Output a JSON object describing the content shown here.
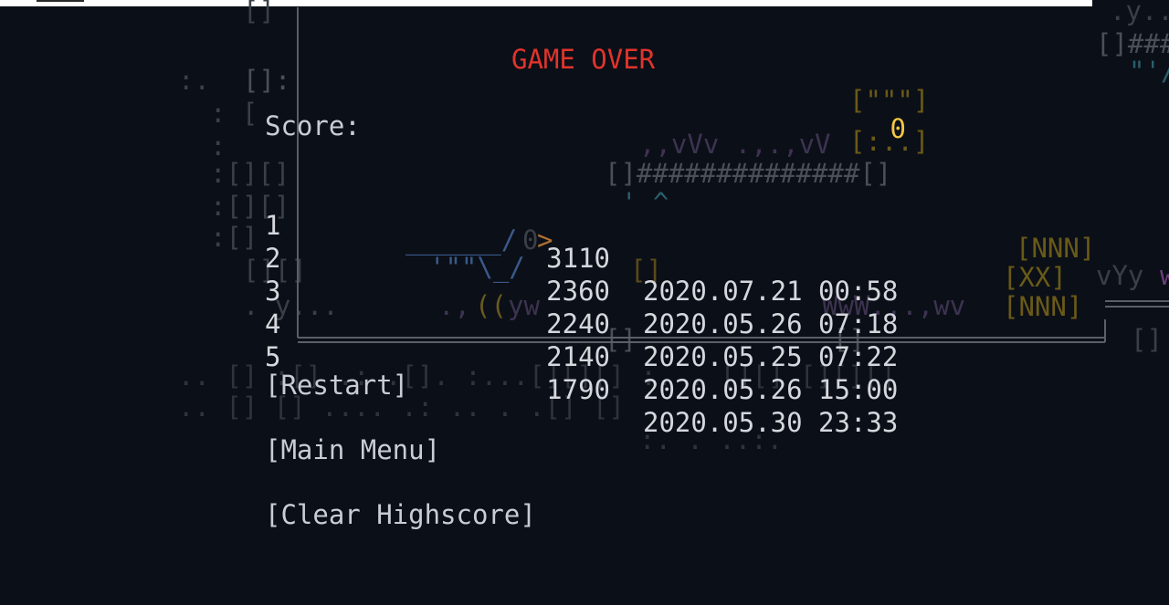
{
  "game": {
    "title": "GAME OVER",
    "score_label": "Score:",
    "score_value": "0"
  },
  "highscores": [
    {
      "rank": "1",
      "score": "3110",
      "date": "2020.07.21 00:58"
    },
    {
      "rank": "2",
      "score": "2360",
      "date": "2020.05.26 07:18"
    },
    {
      "rank": "3",
      "score": "2240",
      "date": "2020.05.25 07:22"
    },
    {
      "rank": "4",
      "score": "2140",
      "date": "2020.05.26 15:00"
    },
    {
      "rank": "5",
      "score": "1790",
      "date": "2020.05.30 23:33"
    }
  ],
  "menu": {
    "restart": "[Restart]",
    "main_menu": "[Main Menu]",
    "clear_highscore": "[Clear Highscore]"
  },
  "colors": {
    "background": "#0b0f17",
    "title": "#e0342c",
    "score_value": "#f2c744",
    "text": "#c9cdd3"
  }
}
